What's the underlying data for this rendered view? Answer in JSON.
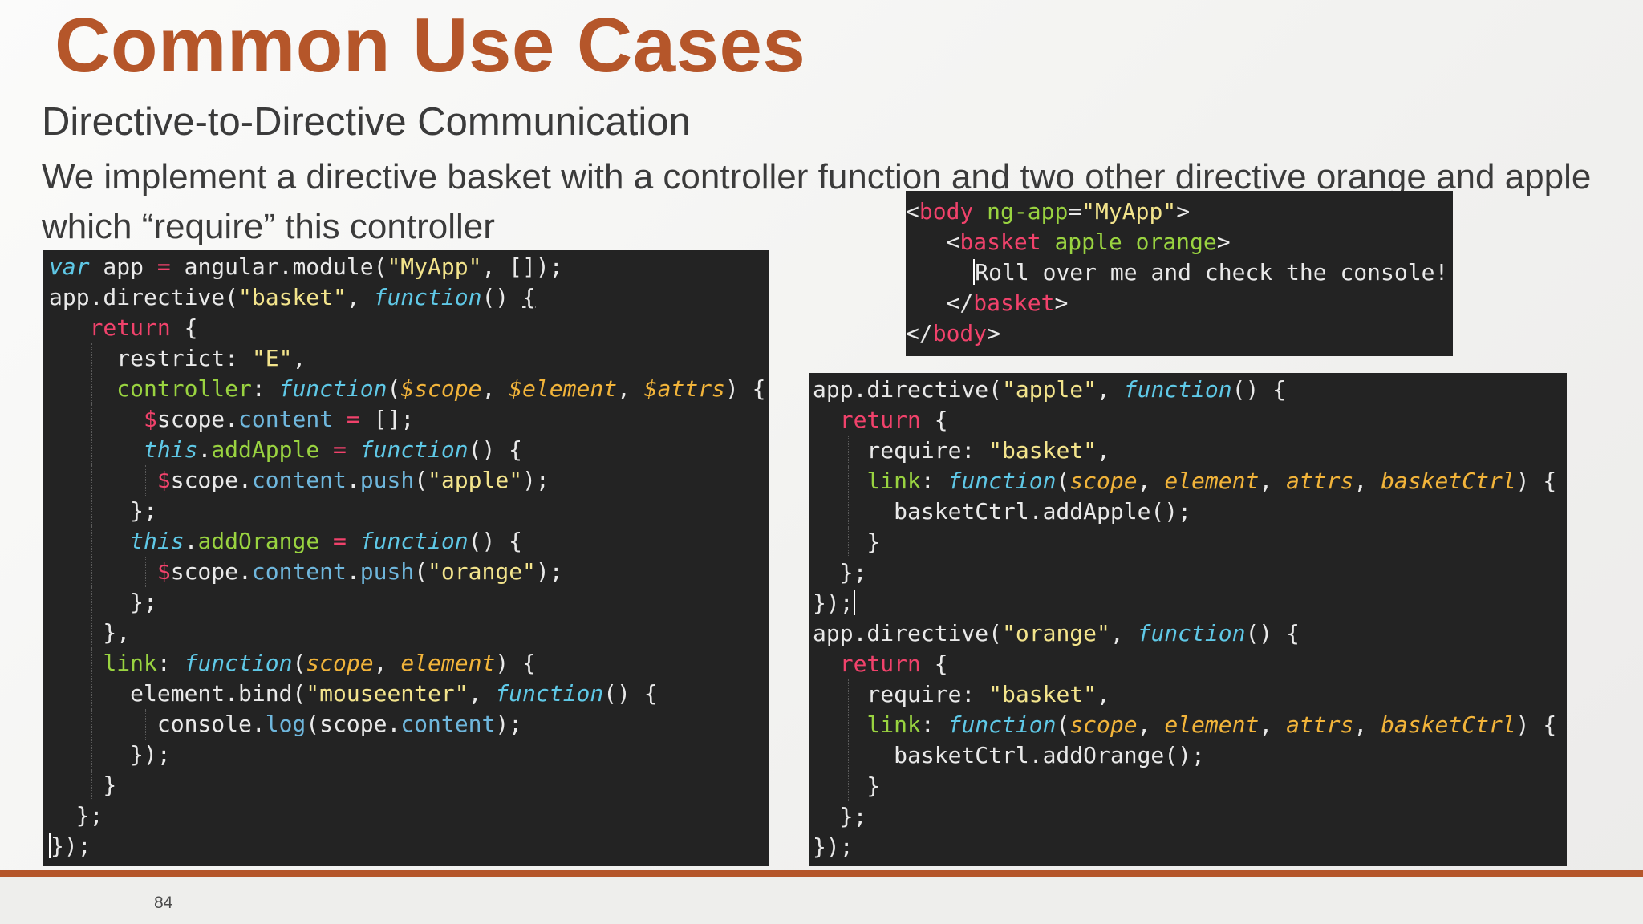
{
  "slide": {
    "title": "Common Use Cases",
    "subtitle": "Directive-to-Directive Communication",
    "description": "We implement a directive basket with a controller function and two other directive orange and apple which “require” this controller",
    "page_number": "84"
  },
  "colors": {
    "accent": "#b5562a",
    "code_background": "#232323",
    "keyword": "#f0426b",
    "function": "#5fc8e6",
    "parameter": "#f2b43a",
    "string": "#f3e48c",
    "property": "#99d340"
  },
  "code": {
    "left": [
      "var app = angular.module(\"MyApp\", []);",
      "app.directive(\"basket\", function() {",
      "  return {",
      "    restrict: \"E\",",
      "    controller: function($scope, $element, $attrs) {",
      "      $scope.content = [];",
      "      this.addApple = function() {",
      "        $scope.content.push(\"apple\");",
      "      };",
      "      this.addOrange = function() {",
      "        $scope.content.push(\"orange\");",
      "      };",
      "    },",
      "    link: function(scope, element) {",
      "      element.bind(\"mouseenter\", function() {",
      "        console.log(scope.content);",
      "      });",
      "    }",
      "  };",
      "});"
    ],
    "html": [
      "<body ng-app=\"MyApp\">",
      "  <basket apple orange>",
      "    Roll over me and check the console!",
      "  </basket>",
      "</body>"
    ],
    "right": [
      "app.directive(\"apple\", function() {",
      "  return {",
      "    require: \"basket\",",
      "    link: function(scope, element, attrs, basketCtrl) {",
      "      basketCtrl.addApple();",
      "    }",
      "  };",
      "});",
      "app.directive(\"orange\", function() {",
      "  return {",
      "    require: \"basket\",",
      "    link: function(scope, element, attrs, basketCtrl) {",
      "      basketCtrl.addOrange();",
      "    }",
      "  };",
      "});"
    ]
  }
}
